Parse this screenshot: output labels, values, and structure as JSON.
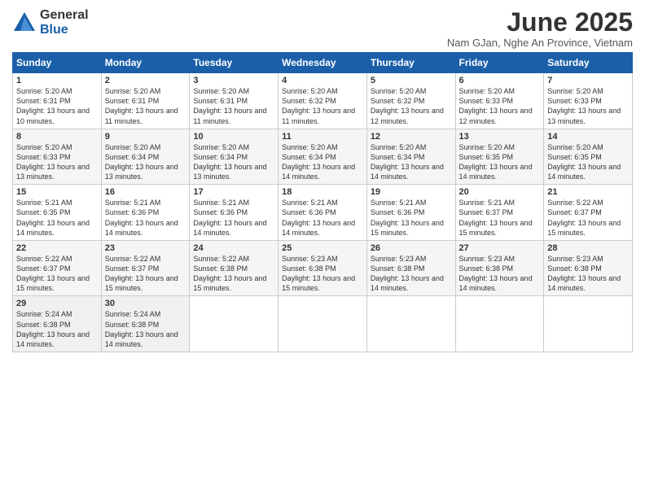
{
  "logo": {
    "general": "General",
    "blue": "Blue"
  },
  "header": {
    "month": "June 2025",
    "location": "Nam GJan, Nghe An Province, Vietnam"
  },
  "days_of_week": [
    "Sunday",
    "Monday",
    "Tuesday",
    "Wednesday",
    "Thursday",
    "Friday",
    "Saturday"
  ],
  "weeks": [
    [
      {
        "num": "1",
        "sunrise": "5:20 AM",
        "sunset": "6:31 PM",
        "daylight": "13 hours and 10 minutes."
      },
      {
        "num": "2",
        "sunrise": "5:20 AM",
        "sunset": "6:31 PM",
        "daylight": "13 hours and 11 minutes."
      },
      {
        "num": "3",
        "sunrise": "5:20 AM",
        "sunset": "6:31 PM",
        "daylight": "13 hours and 11 minutes."
      },
      {
        "num": "4",
        "sunrise": "5:20 AM",
        "sunset": "6:32 PM",
        "daylight": "13 hours and 11 minutes."
      },
      {
        "num": "5",
        "sunrise": "5:20 AM",
        "sunset": "6:32 PM",
        "daylight": "13 hours and 12 minutes."
      },
      {
        "num": "6",
        "sunrise": "5:20 AM",
        "sunset": "6:33 PM",
        "daylight": "13 hours and 12 minutes."
      },
      {
        "num": "7",
        "sunrise": "5:20 AM",
        "sunset": "6:33 PM",
        "daylight": "13 hours and 13 minutes."
      }
    ],
    [
      {
        "num": "8",
        "sunrise": "5:20 AM",
        "sunset": "6:33 PM",
        "daylight": "13 hours and 13 minutes."
      },
      {
        "num": "9",
        "sunrise": "5:20 AM",
        "sunset": "6:34 PM",
        "daylight": "13 hours and 13 minutes."
      },
      {
        "num": "10",
        "sunrise": "5:20 AM",
        "sunset": "6:34 PM",
        "daylight": "13 hours and 13 minutes."
      },
      {
        "num": "11",
        "sunrise": "5:20 AM",
        "sunset": "6:34 PM",
        "daylight": "13 hours and 14 minutes."
      },
      {
        "num": "12",
        "sunrise": "5:20 AM",
        "sunset": "6:34 PM",
        "daylight": "13 hours and 14 minutes."
      },
      {
        "num": "13",
        "sunrise": "5:20 AM",
        "sunset": "6:35 PM",
        "daylight": "13 hours and 14 minutes."
      },
      {
        "num": "14",
        "sunrise": "5:20 AM",
        "sunset": "6:35 PM",
        "daylight": "13 hours and 14 minutes."
      }
    ],
    [
      {
        "num": "15",
        "sunrise": "5:21 AM",
        "sunset": "6:35 PM",
        "daylight": "13 hours and 14 minutes."
      },
      {
        "num": "16",
        "sunrise": "5:21 AM",
        "sunset": "6:36 PM",
        "daylight": "13 hours and 14 minutes."
      },
      {
        "num": "17",
        "sunrise": "5:21 AM",
        "sunset": "6:36 PM",
        "daylight": "13 hours and 14 minutes."
      },
      {
        "num": "18",
        "sunrise": "5:21 AM",
        "sunset": "6:36 PM",
        "daylight": "13 hours and 14 minutes."
      },
      {
        "num": "19",
        "sunrise": "5:21 AM",
        "sunset": "6:36 PM",
        "daylight": "13 hours and 15 minutes."
      },
      {
        "num": "20",
        "sunrise": "5:21 AM",
        "sunset": "6:37 PM",
        "daylight": "13 hours and 15 minutes."
      },
      {
        "num": "21",
        "sunrise": "5:22 AM",
        "sunset": "6:37 PM",
        "daylight": "13 hours and 15 minutes."
      }
    ],
    [
      {
        "num": "22",
        "sunrise": "5:22 AM",
        "sunset": "6:37 PM",
        "daylight": "13 hours and 15 minutes."
      },
      {
        "num": "23",
        "sunrise": "5:22 AM",
        "sunset": "6:37 PM",
        "daylight": "13 hours and 15 minutes."
      },
      {
        "num": "24",
        "sunrise": "5:22 AM",
        "sunset": "6:38 PM",
        "daylight": "13 hours and 15 minutes."
      },
      {
        "num": "25",
        "sunrise": "5:23 AM",
        "sunset": "6:38 PM",
        "daylight": "13 hours and 15 minutes."
      },
      {
        "num": "26",
        "sunrise": "5:23 AM",
        "sunset": "6:38 PM",
        "daylight": "13 hours and 14 minutes."
      },
      {
        "num": "27",
        "sunrise": "5:23 AM",
        "sunset": "6:38 PM",
        "daylight": "13 hours and 14 minutes."
      },
      {
        "num": "28",
        "sunrise": "5:23 AM",
        "sunset": "6:38 PM",
        "daylight": "13 hours and 14 minutes."
      }
    ],
    [
      {
        "num": "29",
        "sunrise": "5:24 AM",
        "sunset": "6:38 PM",
        "daylight": "13 hours and 14 minutes."
      },
      {
        "num": "30",
        "sunrise": "5:24 AM",
        "sunset": "6:38 PM",
        "daylight": "13 hours and 14 minutes."
      },
      null,
      null,
      null,
      null,
      null
    ]
  ]
}
